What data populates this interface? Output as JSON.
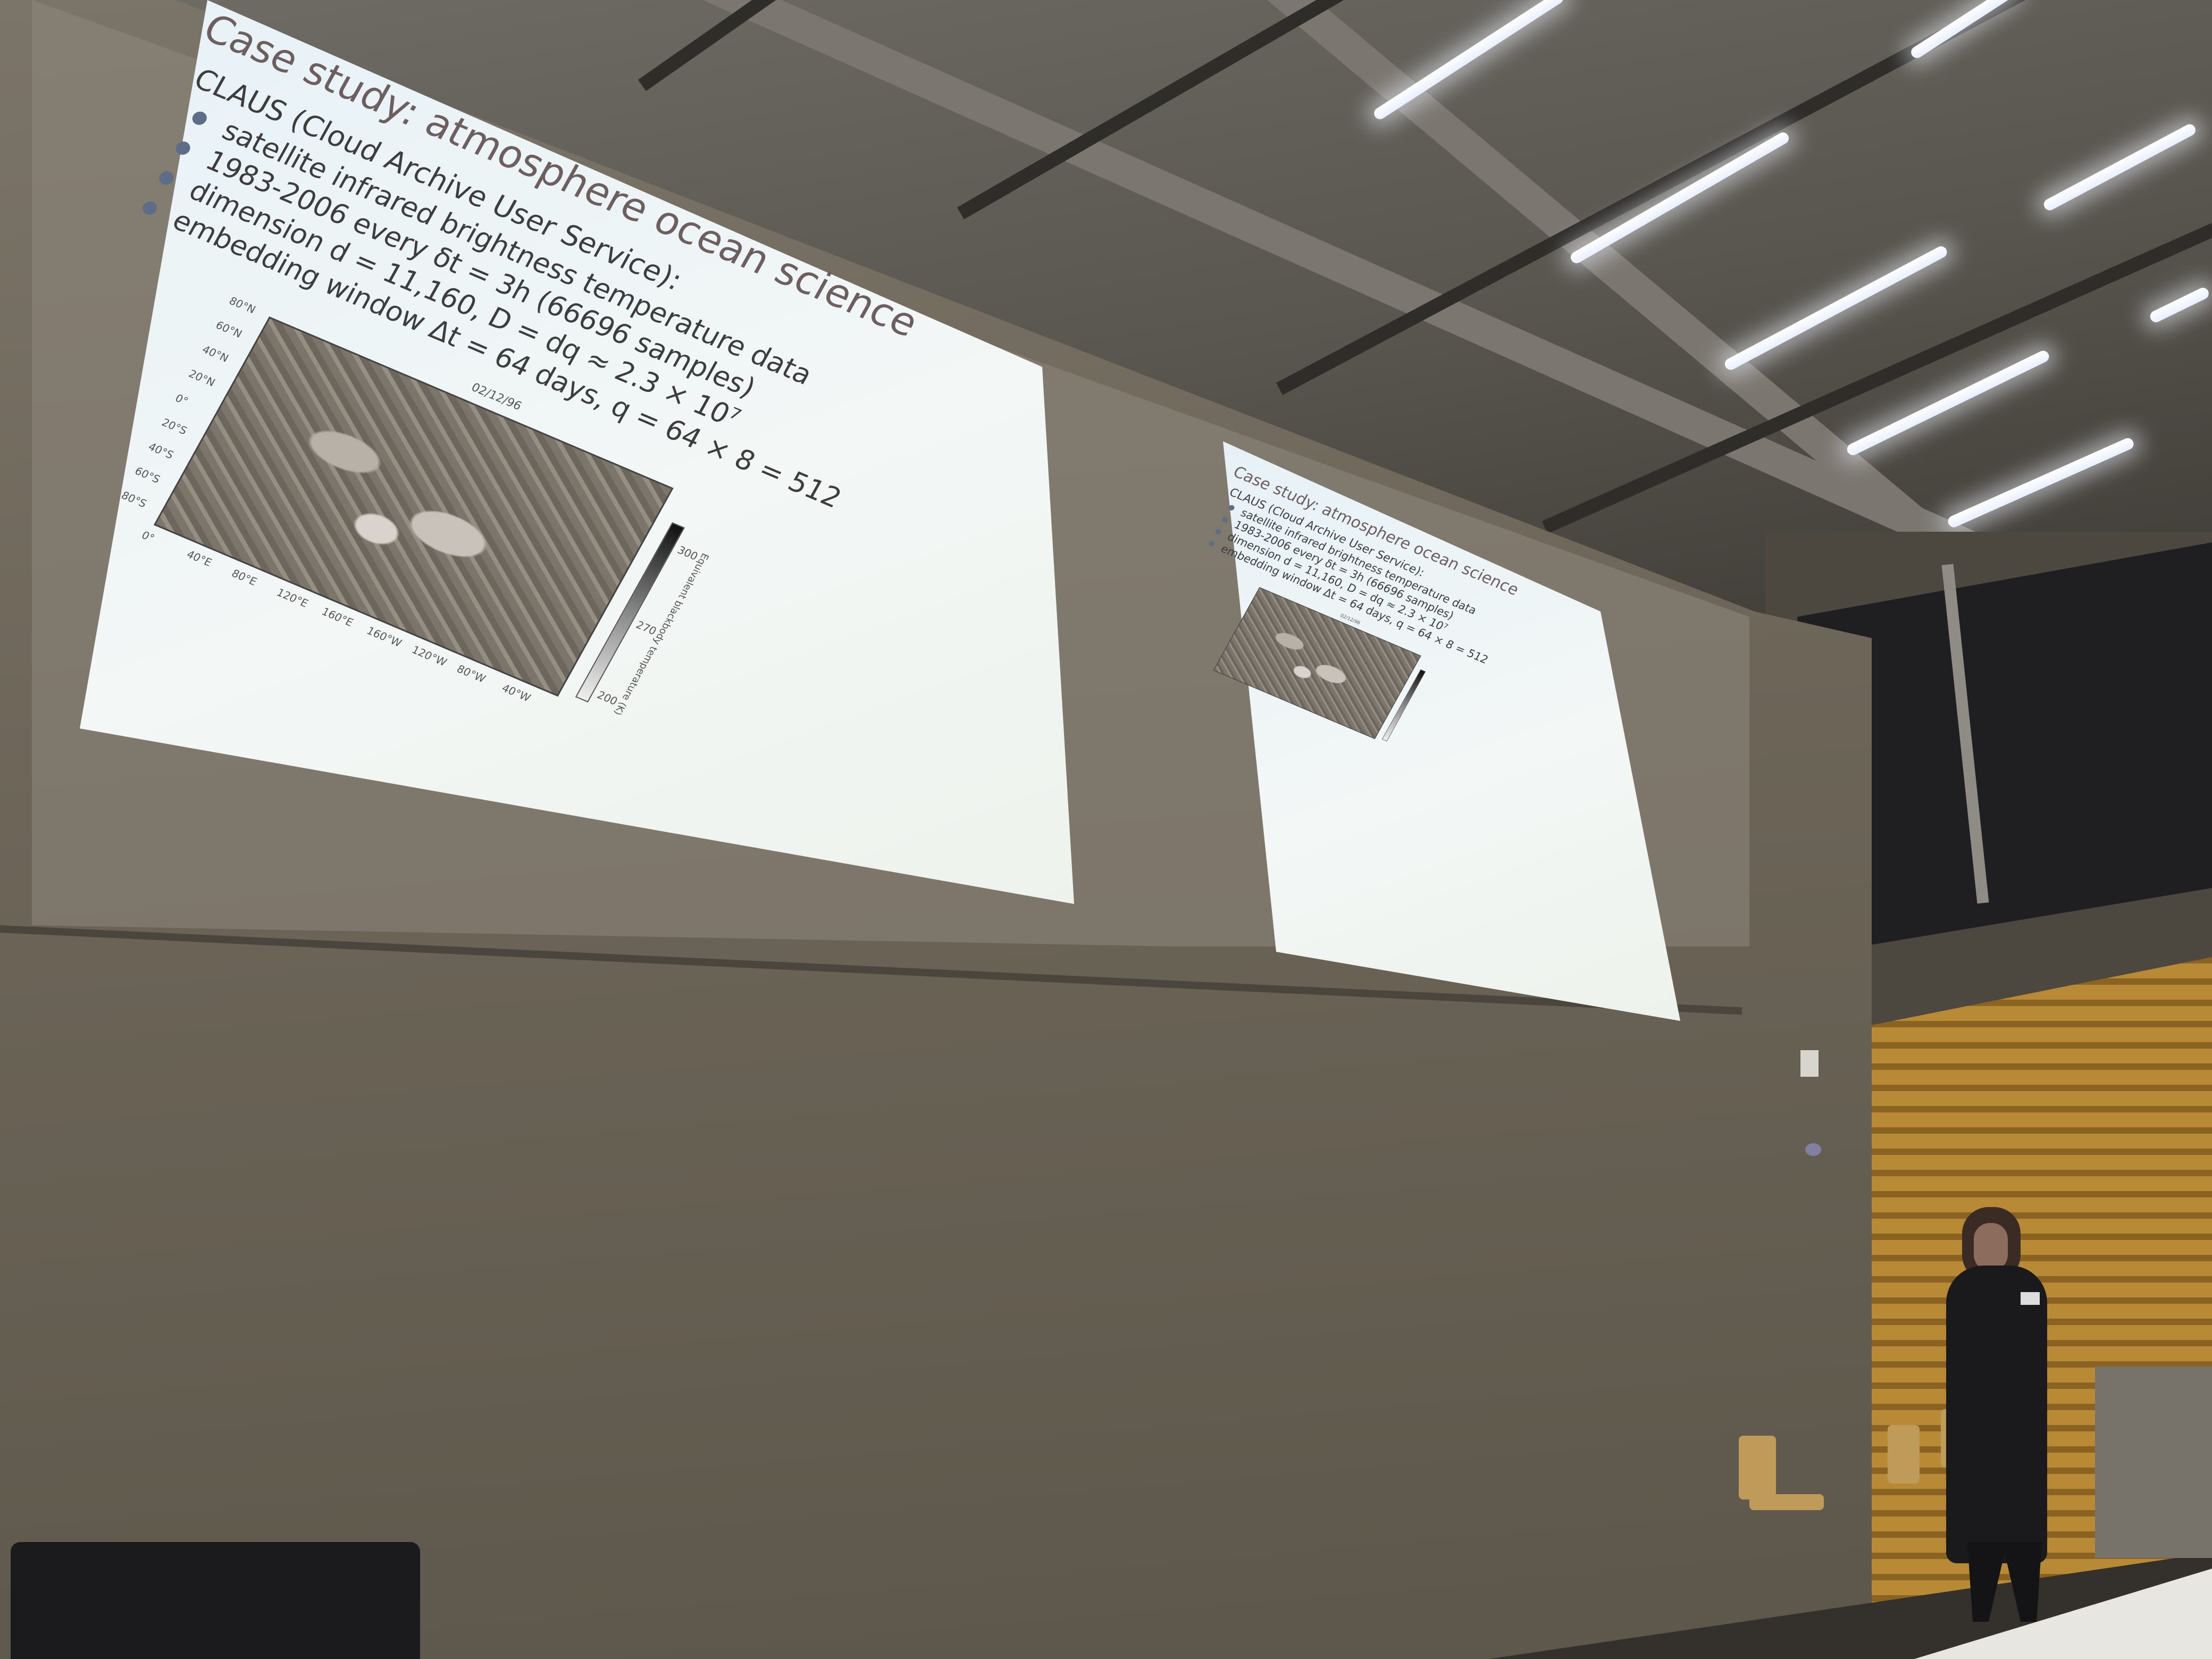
{
  "slide": {
    "title": "Case study: atmosphere ocean science",
    "subtitle": "CLAUS (Cloud Archive User Service):",
    "bullets": [
      "satellite infrared brightness temperature data",
      "1983-2006 every δt = 3h (66696 samples)",
      "dimension d = 11,160, D = dq ≈ 2.3 × 10⁷",
      "embedding window Δt = 64 days, q = 64 × 8 = 512"
    ],
    "figure": {
      "date": "02/12/96",
      "lat_ticks": [
        "80°N",
        "60°N",
        "40°N",
        "20°N",
        "0°",
        "20°S",
        "40°S",
        "60°S",
        "80°S"
      ],
      "lon_ticks": [
        "0°",
        "40°E",
        "80°E",
        "120°E",
        "160°E",
        "160°W",
        "120°W",
        "80°W",
        "40°W"
      ],
      "colorbar_ticks": [
        "300",
        "270",
        "200"
      ],
      "colorbar_label": "Equivalent blackbody temperature (K)"
    }
  },
  "colors": {
    "slide_background": "#eef4f3",
    "title_text": "#6d5f5f",
    "bullet_dot": "#5d6d86",
    "wood_panel": "#b98a36"
  }
}
